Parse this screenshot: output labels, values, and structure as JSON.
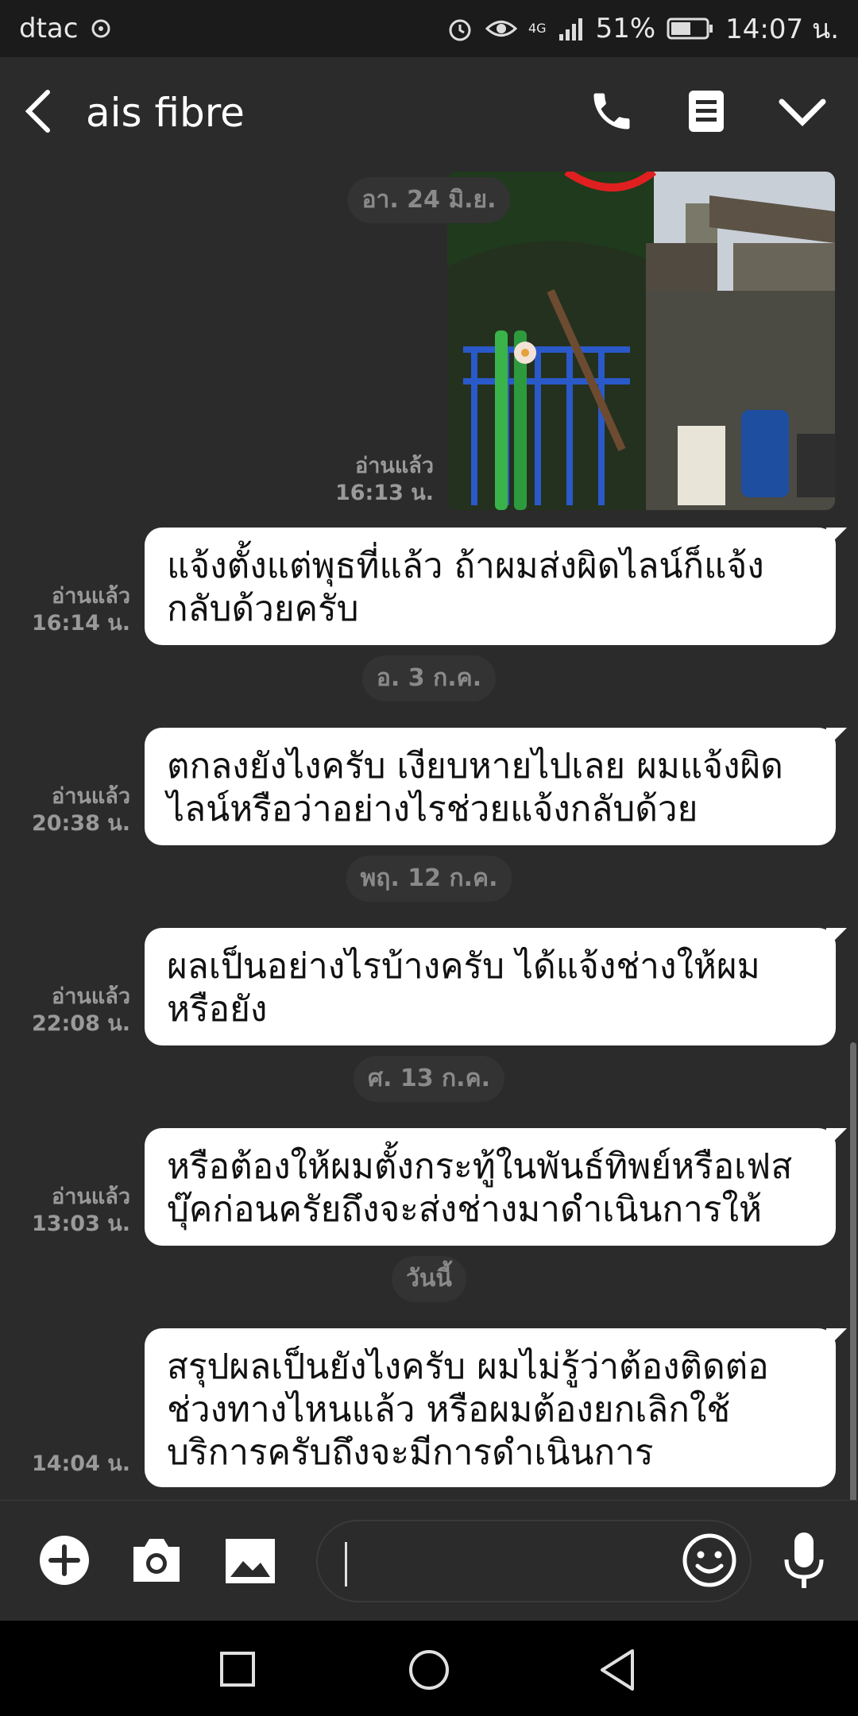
{
  "status": {
    "carrier": "dtac",
    "network": "4G",
    "battery": "51%",
    "time": "14:07 น."
  },
  "header": {
    "title": "ais fibre"
  },
  "messages": [
    {
      "type": "date",
      "text": "อา. 24 มิ.ย."
    },
    {
      "type": "photo",
      "read": "อ่านแล้ว",
      "time": "16:13 น."
    },
    {
      "type": "text",
      "read": "อ่านแล้ว",
      "time": "16:14 น.",
      "lines": [
        "แจ้งตั้งแต่พุธที่แล้ว ถ้าผมส่งผิดไลน์ก็แจ้ง",
        "กลับด้วยครับ"
      ]
    },
    {
      "type": "date",
      "text": "อ. 3 ก.ค."
    },
    {
      "type": "text",
      "read": "อ่านแล้ว",
      "time": "20:38 น.",
      "lines": [
        "ตกลงยังไงครับ เงียบหายไปเลย ผมแจ้งผิด",
        "ไลน์หรือว่าอย่างไรช่วยแจ้งกลับด้วย"
      ]
    },
    {
      "type": "date",
      "text": "พฤ. 12 ก.ค."
    },
    {
      "type": "text",
      "read": "อ่านแล้ว",
      "time": "22:08 น.",
      "lines": [
        "ผลเป็นอย่างไรบ้างครับ ได้แจ้งช่างให้ผม",
        "หรือยัง"
      ]
    },
    {
      "type": "date",
      "text": "ศ. 13 ก.ค."
    },
    {
      "type": "text",
      "read": "อ่านแล้ว",
      "time": "13:03 น.",
      "lines": [
        "หรือต้องให้ผมตั้งกระทู้ในพันธ์ทิพย์หรือเฟส",
        "บุ๊คก่อนครัยถึงจะส่งช่างมาดำเนินการให้"
      ]
    },
    {
      "type": "date",
      "text": "วันนี้"
    },
    {
      "type": "text",
      "read": "",
      "time": "14:04 น.",
      "lines": [
        "สรุปผลเป็นยังไงครับ ผมไม่รู้ว่าต้องติดต่อ",
        "ช่วงทางไหนแล้ว หรือผมต้องยกเลิกใช้",
        "บริการครับถึงจะมีการดำเนินการ"
      ]
    }
  ],
  "colors": {
    "background": "#2b2b2b",
    "bubble": "#ffffff",
    "date_chip": "#333333",
    "meta": "#9a9a9a"
  },
  "icons": {
    "back": "back-arrow-icon",
    "call": "phone-icon",
    "menu": "notes-icon",
    "expand": "chevron-down-icon",
    "add": "plus-icon",
    "camera": "camera-icon",
    "gallery": "image-icon",
    "emoji": "emoji-icon",
    "mic": "microphone-icon"
  }
}
